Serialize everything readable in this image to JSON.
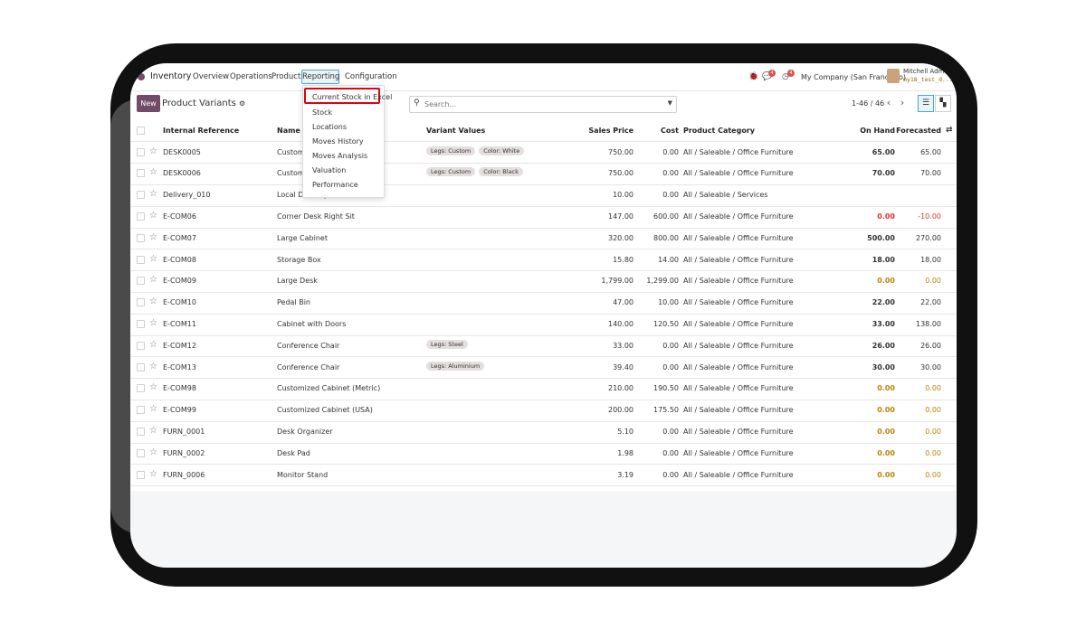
{
  "navbar": {
    "app_name": "Inventory",
    "menu": [
      "Overview",
      "Operations",
      "Products",
      "Reporting",
      "Configuration"
    ],
    "activity_badge": "4",
    "clock_badge": "4",
    "company": "My Company (San Francisco)",
    "user_name": "Mitchell Admin",
    "db_name": "my18_test_d..."
  },
  "control": {
    "new_label": "New",
    "title": "Product Variants",
    "search_placeholder": "Search...",
    "pager": "1-46 / 46"
  },
  "reporting_menu": {
    "items": [
      "Current Stock in Excel",
      "Stock",
      "Locations",
      "Moves History",
      "Moves Analysis",
      "Valuation",
      "Performance"
    ],
    "highlighted": "Current Stock in Excel",
    "highlight_color": "#e3000f"
  },
  "table": {
    "columns": [
      "Internal Reference",
      "Name",
      "Variant Values",
      "Sales Price",
      "Cost",
      "Product Category",
      "On Hand",
      "Forecasted"
    ],
    "rows": [
      {
        "ref": "DESK0005",
        "name": "Customiz...",
        "tags": [
          "Legs: Custom",
          "Color: White"
        ],
        "price": "750.00",
        "cost": "0.00",
        "category": "All / Saleable / Office Furniture",
        "onhand": "65.00",
        "forecast": "65.00",
        "status": "normal"
      },
      {
        "ref": "DESK0006",
        "name": "Customiz...",
        "tags": [
          "Legs: Custom",
          "Color: Black"
        ],
        "price": "750.00",
        "cost": "0.00",
        "category": "All / Saleable / Office Furniture",
        "onhand": "70.00",
        "forecast": "70.00",
        "status": "normal"
      },
      {
        "ref": "Delivery_010",
        "name": "Local Delivery",
        "tags": [],
        "price": "10.00",
        "cost": "0.00",
        "category": "All / Saleable / Services",
        "onhand": "",
        "forecast": "",
        "status": "normal"
      },
      {
        "ref": "E-COM06",
        "name": "Corner Desk Right Sit",
        "tags": [],
        "price": "147.00",
        "cost": "600.00",
        "category": "All / Saleable / Office Furniture",
        "onhand": "0.00",
        "forecast": "-10.00",
        "status": "negative"
      },
      {
        "ref": "E-COM07",
        "name": "Large Cabinet",
        "tags": [],
        "price": "320.00",
        "cost": "800.00",
        "category": "All / Saleable / Office Furniture",
        "onhand": "500.00",
        "forecast": "270.00",
        "status": "normal"
      },
      {
        "ref": "E-COM08",
        "name": "Storage Box",
        "tags": [],
        "price": "15.80",
        "cost": "14.00",
        "category": "All / Saleable / Office Furniture",
        "onhand": "18.00",
        "forecast": "18.00",
        "status": "normal"
      },
      {
        "ref": "E-COM09",
        "name": "Large Desk",
        "tags": [],
        "price": "1,799.00",
        "cost": "1,299.00",
        "category": "All / Saleable / Office Furniture",
        "onhand": "0.00",
        "forecast": "0.00",
        "status": "zero"
      },
      {
        "ref": "E-COM10",
        "name": "Pedal Bin",
        "tags": [],
        "price": "47.00",
        "cost": "10.00",
        "category": "All / Saleable / Office Furniture",
        "onhand": "22.00",
        "forecast": "22.00",
        "status": "normal"
      },
      {
        "ref": "E-COM11",
        "name": "Cabinet with Doors",
        "tags": [],
        "price": "140.00",
        "cost": "120.50",
        "category": "All / Saleable / Office Furniture",
        "onhand": "33.00",
        "forecast": "138.00",
        "status": "normal"
      },
      {
        "ref": "E-COM12",
        "name": "Conference Chair",
        "tags": [
          "Legs: Steel"
        ],
        "price": "33.00",
        "cost": "0.00",
        "category": "All / Saleable / Office Furniture",
        "onhand": "26.00",
        "forecast": "26.00",
        "status": "normal"
      },
      {
        "ref": "E-COM13",
        "name": "Conference Chair",
        "tags": [
          "Legs: Aluminium"
        ],
        "price": "39.40",
        "cost": "0.00",
        "category": "All / Saleable / Office Furniture",
        "onhand": "30.00",
        "forecast": "30.00",
        "status": "normal"
      },
      {
        "ref": "E-COM98",
        "name": "Customized Cabinet (Metric)",
        "tags": [],
        "price": "210.00",
        "cost": "190.50",
        "category": "All / Saleable / Office Furniture",
        "onhand": "0.00",
        "forecast": "0.00",
        "status": "zero"
      },
      {
        "ref": "E-COM99",
        "name": "Customized Cabinet (USA)",
        "tags": [],
        "price": "200.00",
        "cost": "175.50",
        "category": "All / Saleable / Office Furniture",
        "onhand": "0.00",
        "forecast": "0.00",
        "status": "zero"
      },
      {
        "ref": "FURN_0001",
        "name": "Desk Organizer",
        "tags": [],
        "price": "5.10",
        "cost": "0.00",
        "category": "All / Saleable / Office Furniture",
        "onhand": "0.00",
        "forecast": "0.00",
        "status": "zero"
      },
      {
        "ref": "FURN_0002",
        "name": "Desk Pad",
        "tags": [],
        "price": "1.98",
        "cost": "0.00",
        "category": "All / Saleable / Office Furniture",
        "onhand": "0.00",
        "forecast": "0.00",
        "status": "zero"
      },
      {
        "ref": "FURN_0006",
        "name": "Monitor Stand",
        "tags": [],
        "price": "3.19",
        "cost": "0.00",
        "category": "All / Saleable / Office Furniture",
        "onhand": "0.00",
        "forecast": "0.00",
        "status": "zero"
      }
    ]
  },
  "colors": {
    "brand": "#714b67",
    "negative": "#d9362b",
    "zero": "#b8860b"
  }
}
